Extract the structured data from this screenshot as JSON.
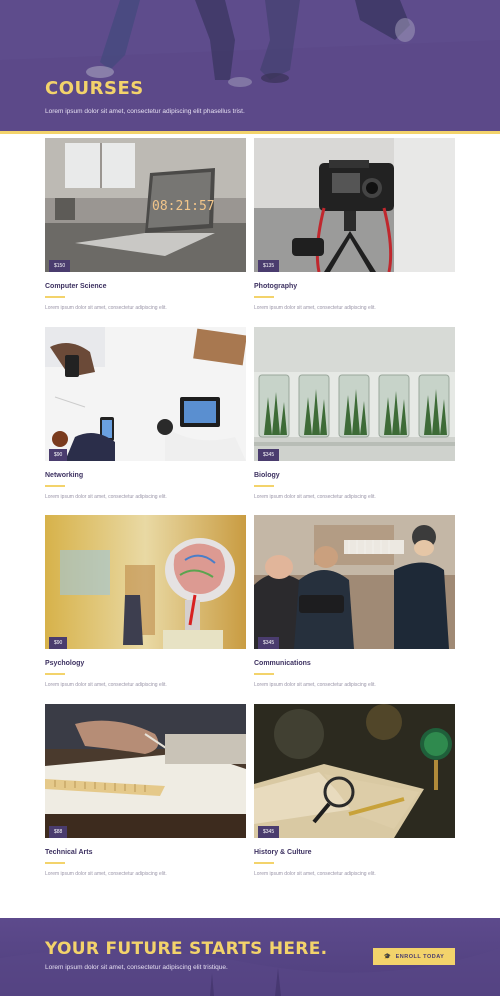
{
  "hero": {
    "title": "COURSES",
    "subtitle": "Lorem ipsum dolor sit amet, consectetur adipiscing elit phasellus trist."
  },
  "courses": [
    {
      "name": "Computer Science",
      "price": "$150",
      "desc": "Lorem ipsum dolor sit amet, consectetur adipiscing elit.",
      "clock_text": "08:21:57"
    },
    {
      "name": "Photography",
      "price": "$135",
      "desc": "Lorem ipsum dolor sit amet, consectetur adipiscing elit."
    },
    {
      "name": "Networking",
      "price": "$90",
      "desc": "Lorem ipsum dolor sit amet, consectetur adipiscing elit."
    },
    {
      "name": "Biology",
      "price": "$345",
      "desc": "Lorem ipsum dolor sit amet, consectetur adipiscing elit."
    },
    {
      "name": "Psychology",
      "price": "$90",
      "desc": "Lorem ipsum dolor sit amet, consectetur adipiscing elit."
    },
    {
      "name": "Communications",
      "price": "$345",
      "desc": "Lorem ipsum dolor sit amet, consectetur adipiscing elit."
    },
    {
      "name": "Technical Arts",
      "price": "$88",
      "desc": "Lorem ipsum dolor sit amet, consectetur adipiscing elit."
    },
    {
      "name": "History & Culture",
      "price": "$345",
      "desc": "Lorem ipsum dolor sit amet, consectetur adipiscing elit."
    }
  ],
  "cta": {
    "title": "YOUR FUTURE STARTS HERE.",
    "subtitle": "Lorem ipsum dolor sit amet, consectetur adipiscing elit tristique.",
    "button_label": "ENROLL TODAY",
    "button_icon": "graduation-cap-icon"
  },
  "colors": {
    "accent": "#f3d36b",
    "brand": "#5a4787",
    "price_badge": "#4a3c6e",
    "title_text": "#3d3161"
  }
}
